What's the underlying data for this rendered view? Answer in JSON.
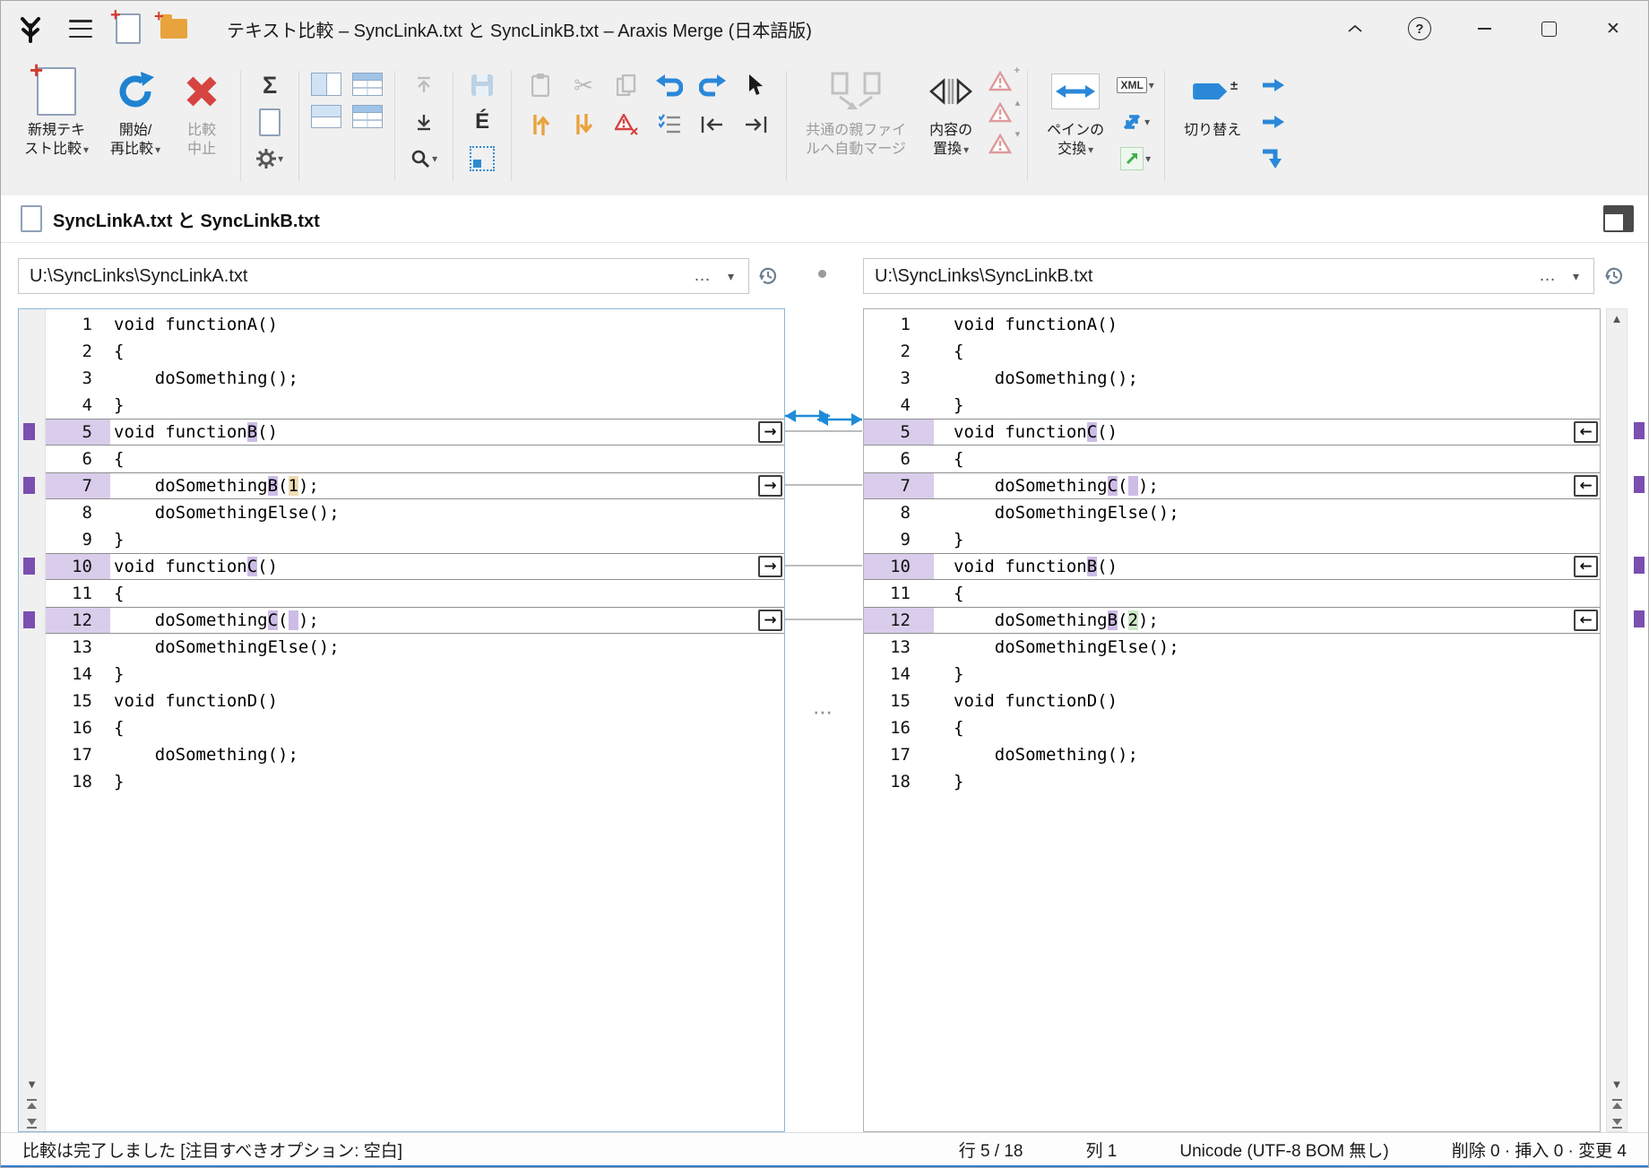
{
  "window": {
    "title": "テキスト比較 – SyncLinkA.txt と SyncLinkB.txt – Araxis Merge (日本語版)"
  },
  "glyphs": {
    "caret": "▾",
    "more": "…",
    "ellipsis": "⋯",
    "dot": "•",
    "scroll_up": "▲",
    "scroll_down": "▼",
    "merge_left": "←",
    "merge_right": "→",
    "help": "?",
    "close": "✕",
    "scissors": "✂"
  },
  "toolbar": {
    "new_compare_l1": "新規テキ",
    "new_compare_l2": "スト比較",
    "start_l1": "開始/",
    "start_l2": "再比較",
    "abort_l1": "比較",
    "abort_l2": "中止",
    "automerge_l1": "共通の親ファイ",
    "automerge_l2": "ルへ自動マージ",
    "replace_l1": "内容の",
    "replace_l2": "置換",
    "swap_l1": "ペインの",
    "swap_l2": "交換",
    "toggle_label": "切り替え",
    "xml_label": "XML",
    "eacute_label": "É",
    "sigma_label": "Σ"
  },
  "tab": {
    "title": "SyncLinkA.txt と SyncLinkB.txt"
  },
  "sync_link": {
    "before_line": 5
  },
  "colors": {
    "accent_blue": "#1e8bd8",
    "changed_bg": "#d9cdeb",
    "changed_char_bg": "#cdbce6",
    "deleted_char_bg": "#f0dcb4",
    "inserted_char_bg": "#cfe8c8",
    "mark_purple": "#7a4fb0"
  },
  "left_pane": {
    "path": "U:\\SyncLinks\\SyncLinkA.txt",
    "lines": [
      {
        "n": 1,
        "segs": [
          {
            "t": "void functionA()"
          }
        ]
      },
      {
        "n": 2,
        "segs": [
          {
            "t": "{"
          }
        ]
      },
      {
        "n": 3,
        "segs": [
          {
            "t": "    doSomething();"
          }
        ]
      },
      {
        "n": 4,
        "segs": [
          {
            "t": "}"
          }
        ]
      },
      {
        "n": 5,
        "changed": true,
        "segs": [
          {
            "t": "void function"
          },
          {
            "t": "B",
            "h": "ch"
          },
          {
            "t": "()"
          }
        ]
      },
      {
        "n": 6,
        "segs": [
          {
            "t": "{"
          }
        ]
      },
      {
        "n": 7,
        "changed": true,
        "segs": [
          {
            "t": "    doSomething"
          },
          {
            "t": "B",
            "h": "ch"
          },
          {
            "t": "("
          },
          {
            "t": "1",
            "h": "del"
          },
          {
            "t": ");"
          }
        ]
      },
      {
        "n": 8,
        "segs": [
          {
            "t": "    doSomethingElse();"
          }
        ]
      },
      {
        "n": 9,
        "segs": [
          {
            "t": "}"
          }
        ]
      },
      {
        "n": 10,
        "changed": true,
        "segs": [
          {
            "t": "void function"
          },
          {
            "t": "C",
            "h": "ch"
          },
          {
            "t": "()"
          }
        ]
      },
      {
        "n": 11,
        "segs": [
          {
            "t": "{"
          }
        ]
      },
      {
        "n": 12,
        "changed": true,
        "segs": [
          {
            "t": "    doSomething"
          },
          {
            "t": "C",
            "h": "ch"
          },
          {
            "t": "("
          },
          {
            "t": " ",
            "h": "ch"
          },
          {
            "t": ");"
          }
        ]
      },
      {
        "n": 13,
        "segs": [
          {
            "t": "    doSomethingElse();"
          }
        ]
      },
      {
        "n": 14,
        "segs": [
          {
            "t": "}"
          }
        ]
      },
      {
        "n": 15,
        "segs": [
          {
            "t": "void functionD()"
          }
        ]
      },
      {
        "n": 16,
        "segs": [
          {
            "t": "{"
          }
        ]
      },
      {
        "n": 17,
        "segs": [
          {
            "t": "    doSomething();"
          }
        ]
      },
      {
        "n": 18,
        "segs": [
          {
            "t": "}"
          }
        ]
      }
    ]
  },
  "right_pane": {
    "path": "U:\\SyncLinks\\SyncLinkB.txt",
    "lines": [
      {
        "n": 1,
        "segs": [
          {
            "t": "void functionA()"
          }
        ]
      },
      {
        "n": 2,
        "segs": [
          {
            "t": "{"
          }
        ]
      },
      {
        "n": 3,
        "segs": [
          {
            "t": "    doSomething();"
          }
        ]
      },
      {
        "n": 4,
        "segs": [
          {
            "t": "}"
          }
        ]
      },
      {
        "n": 5,
        "changed": true,
        "segs": [
          {
            "t": "void function"
          },
          {
            "t": "C",
            "h": "ch"
          },
          {
            "t": "()"
          }
        ]
      },
      {
        "n": 6,
        "segs": [
          {
            "t": "{"
          }
        ]
      },
      {
        "n": 7,
        "changed": true,
        "segs": [
          {
            "t": "    doSomething"
          },
          {
            "t": "C",
            "h": "ch"
          },
          {
            "t": "("
          },
          {
            "t": " ",
            "h": "ch"
          },
          {
            "t": ");"
          }
        ]
      },
      {
        "n": 8,
        "segs": [
          {
            "t": "    doSomethingElse();"
          }
        ]
      },
      {
        "n": 9,
        "segs": [
          {
            "t": "}"
          }
        ]
      },
      {
        "n": 10,
        "changed": true,
        "segs": [
          {
            "t": "void function"
          },
          {
            "t": "B",
            "h": "ch"
          },
          {
            "t": "()"
          }
        ]
      },
      {
        "n": 11,
        "segs": [
          {
            "t": "{"
          }
        ]
      },
      {
        "n": 12,
        "changed": true,
        "segs": [
          {
            "t": "    doSomething"
          },
          {
            "t": "B",
            "h": "ch"
          },
          {
            "t": "("
          },
          {
            "t": "2",
            "h": "ins"
          },
          {
            "t": ");"
          }
        ]
      },
      {
        "n": 13,
        "segs": [
          {
            "t": "    doSomethingElse();"
          }
        ]
      },
      {
        "n": 14,
        "segs": [
          {
            "t": "}"
          }
        ]
      },
      {
        "n": 15,
        "segs": [
          {
            "t": "void functionD()"
          }
        ]
      },
      {
        "n": 16,
        "segs": [
          {
            "t": "{"
          }
        ]
      },
      {
        "n": 17,
        "segs": [
          {
            "t": "    doSomething();"
          }
        ]
      },
      {
        "n": 18,
        "segs": [
          {
            "t": "}"
          }
        ]
      }
    ]
  },
  "statusbar": {
    "message": "比較は完了しました [注目すべきオプション: 空白]",
    "line_indicator": "行 5 / 18",
    "column_indicator": "列 1",
    "encoding": "Unicode (UTF-8 BOM 無し)",
    "change_summary": "削除 0 · 挿入 0 · 変更 4"
  }
}
